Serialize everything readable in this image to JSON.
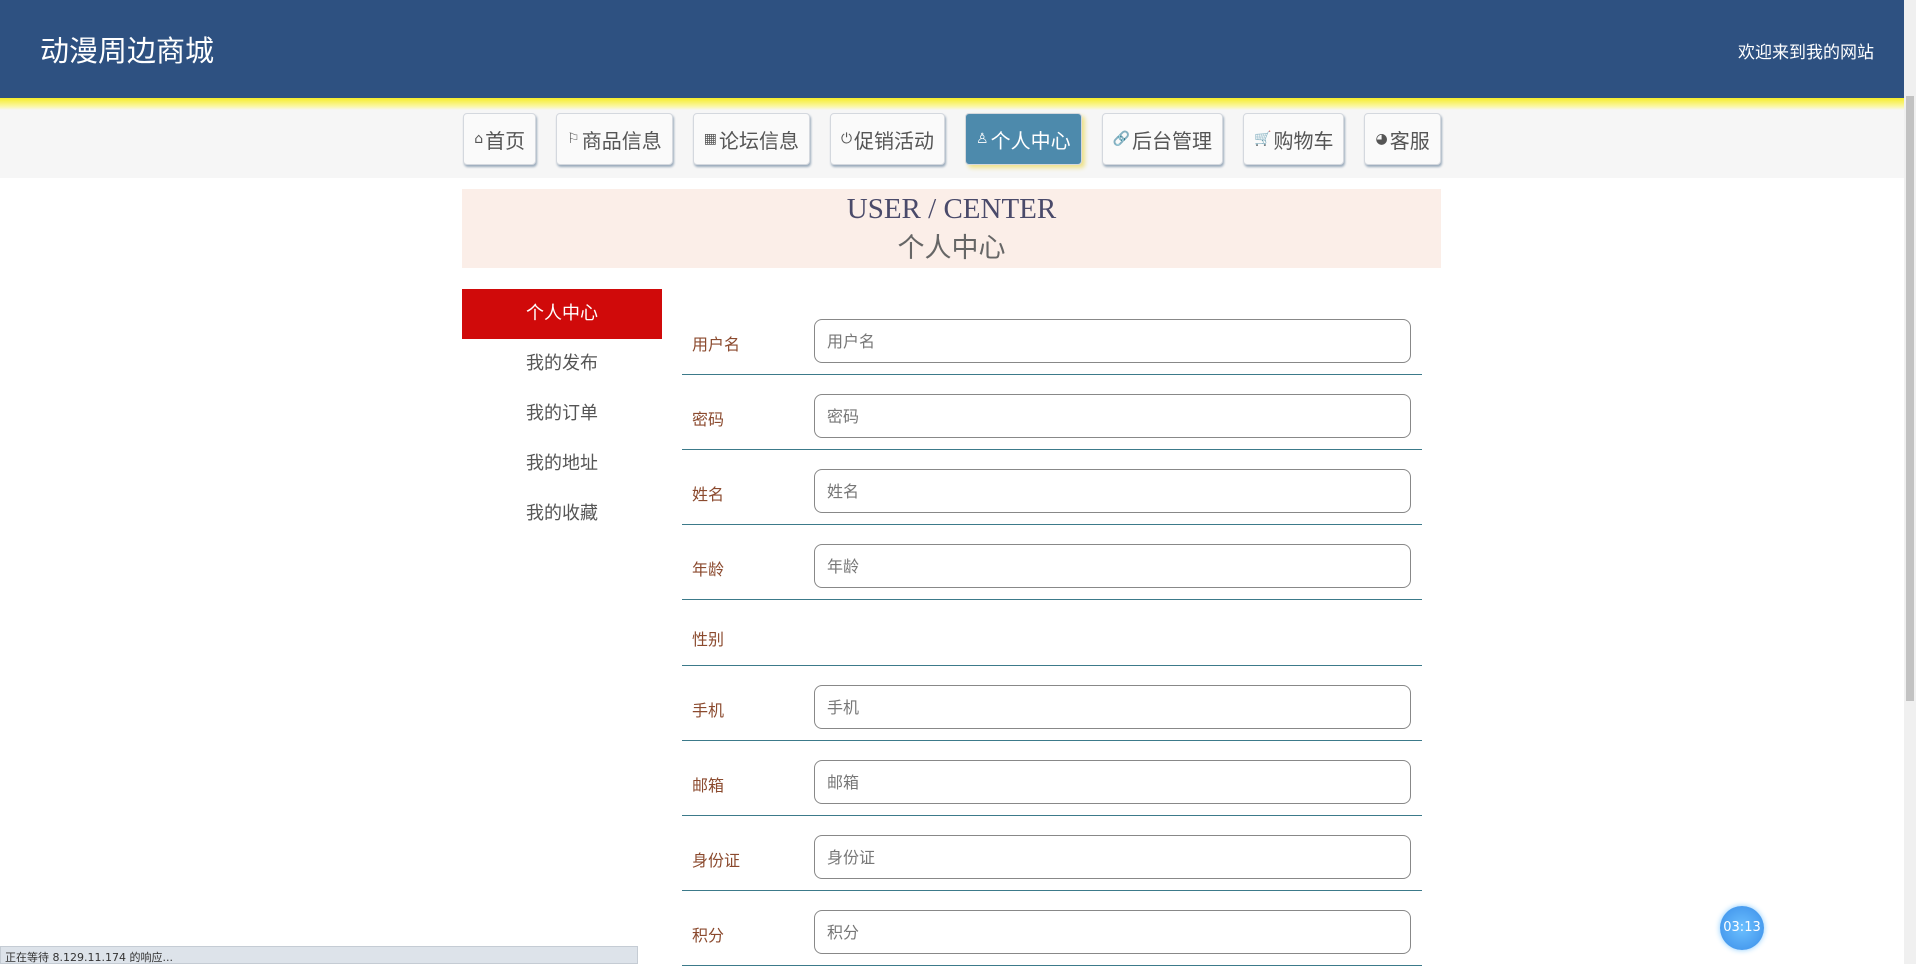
{
  "header": {
    "brand": "动漫周边商城",
    "welcome": "欢迎来到我的网站"
  },
  "nav": [
    {
      "icon": "home-icon",
      "glyph": "⌂",
      "label": "首页"
    },
    {
      "icon": "flag-icon",
      "glyph": "⚐",
      "label": "商品信息"
    },
    {
      "icon": "grid-icon",
      "glyph": "▦",
      "label": "论坛信息"
    },
    {
      "icon": "power-icon",
      "glyph": "⏻",
      "label": "促销活动"
    },
    {
      "icon": "user-icon",
      "glyph": "♙",
      "label": "个人中心",
      "active": true
    },
    {
      "icon": "link-icon",
      "glyph": "🔗",
      "label": "后台管理"
    },
    {
      "icon": "cart-icon",
      "glyph": "🛒",
      "label": "购物车"
    },
    {
      "icon": "chat-icon",
      "glyph": "◕",
      "label": "客服"
    }
  ],
  "banner": {
    "en": "USER / CENTER",
    "cn": "个人中心"
  },
  "sidebar": [
    {
      "label": "个人中心",
      "active": true
    },
    {
      "label": "我的发布"
    },
    {
      "label": "我的订单"
    },
    {
      "label": "我的地址"
    },
    {
      "label": "我的收藏"
    }
  ],
  "form": [
    {
      "label": "用户名",
      "placeholder": "用户名"
    },
    {
      "label": "密码",
      "placeholder": "密码"
    },
    {
      "label": "姓名",
      "placeholder": "姓名"
    },
    {
      "label": "年龄",
      "placeholder": "年龄"
    },
    {
      "label": "性别"
    },
    {
      "label": "手机",
      "placeholder": "手机"
    },
    {
      "label": "邮箱",
      "placeholder": "邮箱"
    },
    {
      "label": "身份证",
      "placeholder": "身份证"
    },
    {
      "label": "积分",
      "placeholder": "积分"
    }
  ],
  "status": "正在等待 8.129.11.174 的响应...",
  "timer": "03:13",
  "colors": {
    "header": "#2e5181",
    "active_nav": "#4d8aac",
    "active_side": "#d00a0a"
  }
}
